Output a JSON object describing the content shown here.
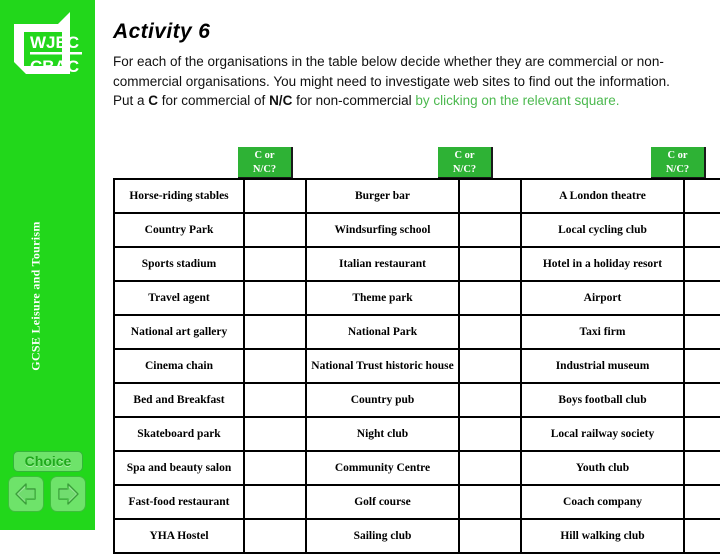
{
  "sidebar": {
    "logo_line1": "WJEC",
    "logo_line2": "CBAC",
    "course_title": "GCSE Leisure and Tourism",
    "choice_label": "Choice",
    "back_label": "back-arrow-icon",
    "next_label": "forward-arrow-icon",
    "background_color": "#22D71B"
  },
  "main": {
    "title": "Activity 6",
    "intro": {
      "line1": "For each of the organisations in the table below decide whether they are commercial",
      "line2": "or non-commercial organisations. You might need to investigate web sites to find out",
      "line3": "the information.",
      "line4_part1": "Put a ",
      "line4_bold1": "C",
      "line4_part2": " for commercial of ",
      "line4_bold2": "N/C",
      "line4_part3": " for non-commercial ",
      "line4_green": "by clicking on the relevant square."
    }
  },
  "table": {
    "header_chip": "C or\nN/C?",
    "header_chip_line1": "C or",
    "header_chip_line2": "N/C?",
    "header_color": "#2EB235",
    "rows": [
      {
        "c1": "Horse-riding stables",
        "a1": "",
        "c2": "Burger bar",
        "a2": "",
        "c3": "A London theatre",
        "a3": ""
      },
      {
        "c1": "Country Park",
        "a1": "",
        "c2": "Windsurfing school",
        "a2": "",
        "c3": "Local cycling club",
        "a3": ""
      },
      {
        "c1": "Sports stadium",
        "a1": "",
        "c2": "Italian restaurant",
        "a2": "",
        "c3": "Hotel in a holiday resort",
        "a3": ""
      },
      {
        "c1": "Travel agent",
        "a1": "",
        "c2": "Theme park",
        "a2": "",
        "c3": "Airport",
        "a3": ""
      },
      {
        "c1": "National art gallery",
        "a1": "",
        "c2": "National Park",
        "a2": "",
        "c3": "Taxi firm",
        "a3": ""
      },
      {
        "c1": "Cinema chain",
        "a1": "",
        "c2": "National Trust historic house",
        "a2": "",
        "c3": "Industrial museum",
        "a3": ""
      },
      {
        "c1": "Bed and Breakfast",
        "a1": "",
        "c2": "Country pub",
        "a2": "",
        "c3": "Boys football club",
        "a3": ""
      },
      {
        "c1": "Skateboard park",
        "a1": "",
        "c2": "Night club",
        "a2": "",
        "c3": "Local railway society",
        "a3": ""
      },
      {
        "c1": "Spa and beauty salon",
        "a1": "",
        "c2": "Community Centre",
        "a2": "",
        "c3": "Youth club",
        "a3": ""
      },
      {
        "c1": "Fast-food restaurant",
        "a1": "",
        "c2": "Golf course",
        "a2": "",
        "c3": "Coach company",
        "a3": ""
      },
      {
        "c1": "YHA Hostel",
        "a1": "",
        "c2": "Sailing club",
        "a2": "",
        "c3": "Hill walking club",
        "a3": ""
      }
    ]
  }
}
